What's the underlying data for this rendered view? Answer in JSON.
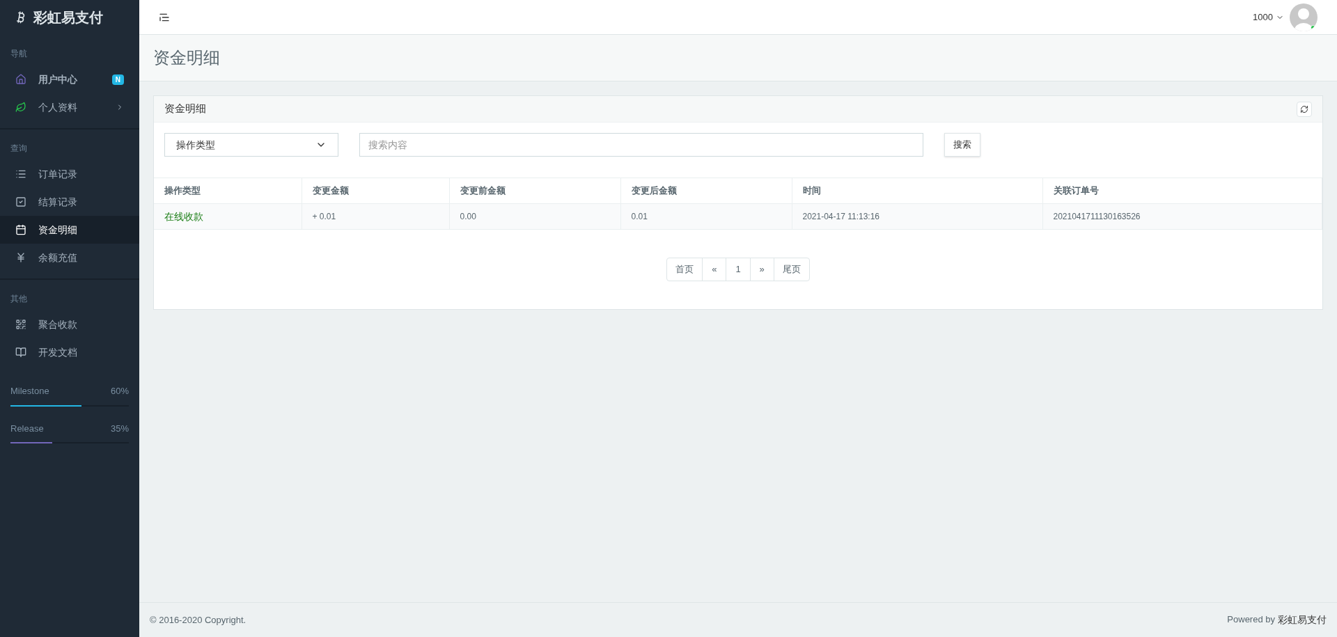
{
  "brand": "彩虹易支付",
  "sidebar": {
    "sections": [
      {
        "title": "导航",
        "items": [
          {
            "label": "用户中心",
            "badge": "N",
            "bold": true,
            "selected": false,
            "has_children": false
          },
          {
            "label": "个人资料",
            "bold": false,
            "selected": false,
            "has_children": true
          }
        ]
      },
      {
        "title": "查询",
        "items": [
          {
            "label": "订单记录",
            "bold": false,
            "selected": false,
            "has_children": false
          },
          {
            "label": "结算记录",
            "bold": false,
            "selected": false,
            "has_children": false
          },
          {
            "label": "资金明细",
            "bold": false,
            "selected": true,
            "has_children": false
          },
          {
            "label": "余额充值",
            "bold": false,
            "selected": false,
            "has_children": false
          }
        ]
      },
      {
        "title": "其他",
        "items": [
          {
            "label": "聚合收款",
            "bold": false,
            "selected": false,
            "has_children": false
          },
          {
            "label": "开发文档",
            "bold": false,
            "selected": false,
            "has_children": false
          }
        ]
      }
    ],
    "progress": [
      {
        "name": "Milestone",
        "reading": "60%",
        "level": 0.6,
        "color": "#23b7e5"
      },
      {
        "name": "Release",
        "reading": "35%",
        "level": 0.35,
        "color": "#7266ba"
      }
    ]
  },
  "header": {
    "user": "1000"
  },
  "page_title": "资金明细",
  "panel": {
    "title": "资金明细",
    "filter": {
      "select": "操作类型",
      "placeholder": "搜索内容",
      "button": "搜索"
    },
    "table": {
      "columns": [
        "操作类型",
        "变更金额",
        "变更前金额",
        "变更后金额",
        "时间",
        "关联订单号"
      ],
      "rows": [
        [
          "在线收款",
          "+ 0.01",
          "0.00",
          "0.01",
          "2021-04-17 11:13:16",
          "2021041711130163526"
        ]
      ]
    },
    "pagination": [
      "首页",
      "«",
      "1",
      "»",
      "尾页"
    ]
  },
  "footer": {
    "copyright": "© 2016-2020 Copyright.",
    "powered": "Powered by",
    "powered_brand": "彩虹易支付"
  }
}
